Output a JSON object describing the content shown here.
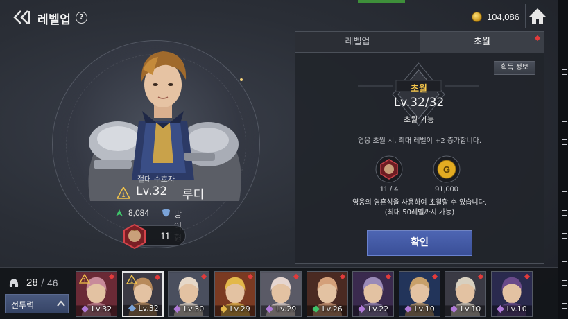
{
  "header": {
    "title": "레벨업",
    "help_icon": "?",
    "gold": "104,086"
  },
  "hero": {
    "title": "절대 수호자",
    "star": "1",
    "level": "Lv.32",
    "name": "루디",
    "power": "8,084",
    "class": "방어형",
    "soul_count": "11"
  },
  "panel": {
    "tabs": [
      {
        "label": "레벨업",
        "active": false
      },
      {
        "label": "초월",
        "active": true
      }
    ],
    "info_button": "획득 정보",
    "ascend_label": "초월",
    "ascend_level": "Lv.32/32",
    "ascend_status": "초월 가능",
    "description": "영웅 초월 시, 최대 레벨이 +2 증가합니다.",
    "costs": {
      "soul": "11 / 4",
      "gold": "91,000"
    },
    "notice_line1": "영웅의 영혼석을 사용하여 초월할 수 있습니다.",
    "notice_line2": "(최대 50레벨까지 가능)",
    "confirm_button": "확인"
  },
  "roster": {
    "count_current": "28",
    "count_separator": "/",
    "count_total": "46",
    "sort_button": "전투력",
    "cards": [
      {
        "level": "Lv.32",
        "star": "1",
        "class": "attack",
        "selected": false
      },
      {
        "level": "Lv.32",
        "star": "1",
        "class": "defense",
        "selected": true
      },
      {
        "level": "Lv.30",
        "star": "",
        "class": "attack",
        "selected": false
      },
      {
        "level": "Lv.29",
        "star": "",
        "class": "support",
        "selected": false
      },
      {
        "level": "Lv.29",
        "star": "",
        "class": "attack",
        "selected": false
      },
      {
        "level": "Lv.26",
        "star": "",
        "class": "heal",
        "selected": false
      },
      {
        "level": "Lv.22",
        "star": "",
        "class": "attack",
        "selected": false
      },
      {
        "level": "Lv.10",
        "star": "",
        "class": "attack",
        "selected": false
      },
      {
        "level": "Lv.10",
        "star": "",
        "class": "attack",
        "selected": false
      },
      {
        "level": "Lv.10",
        "star": "",
        "class": "attack",
        "selected": false
      }
    ]
  },
  "colors": {
    "accent_gold": "#f5c64a",
    "confirm_blue": "#4e66b4",
    "notify_red": "#e23b3b",
    "power_green": "#3fc46a"
  }
}
